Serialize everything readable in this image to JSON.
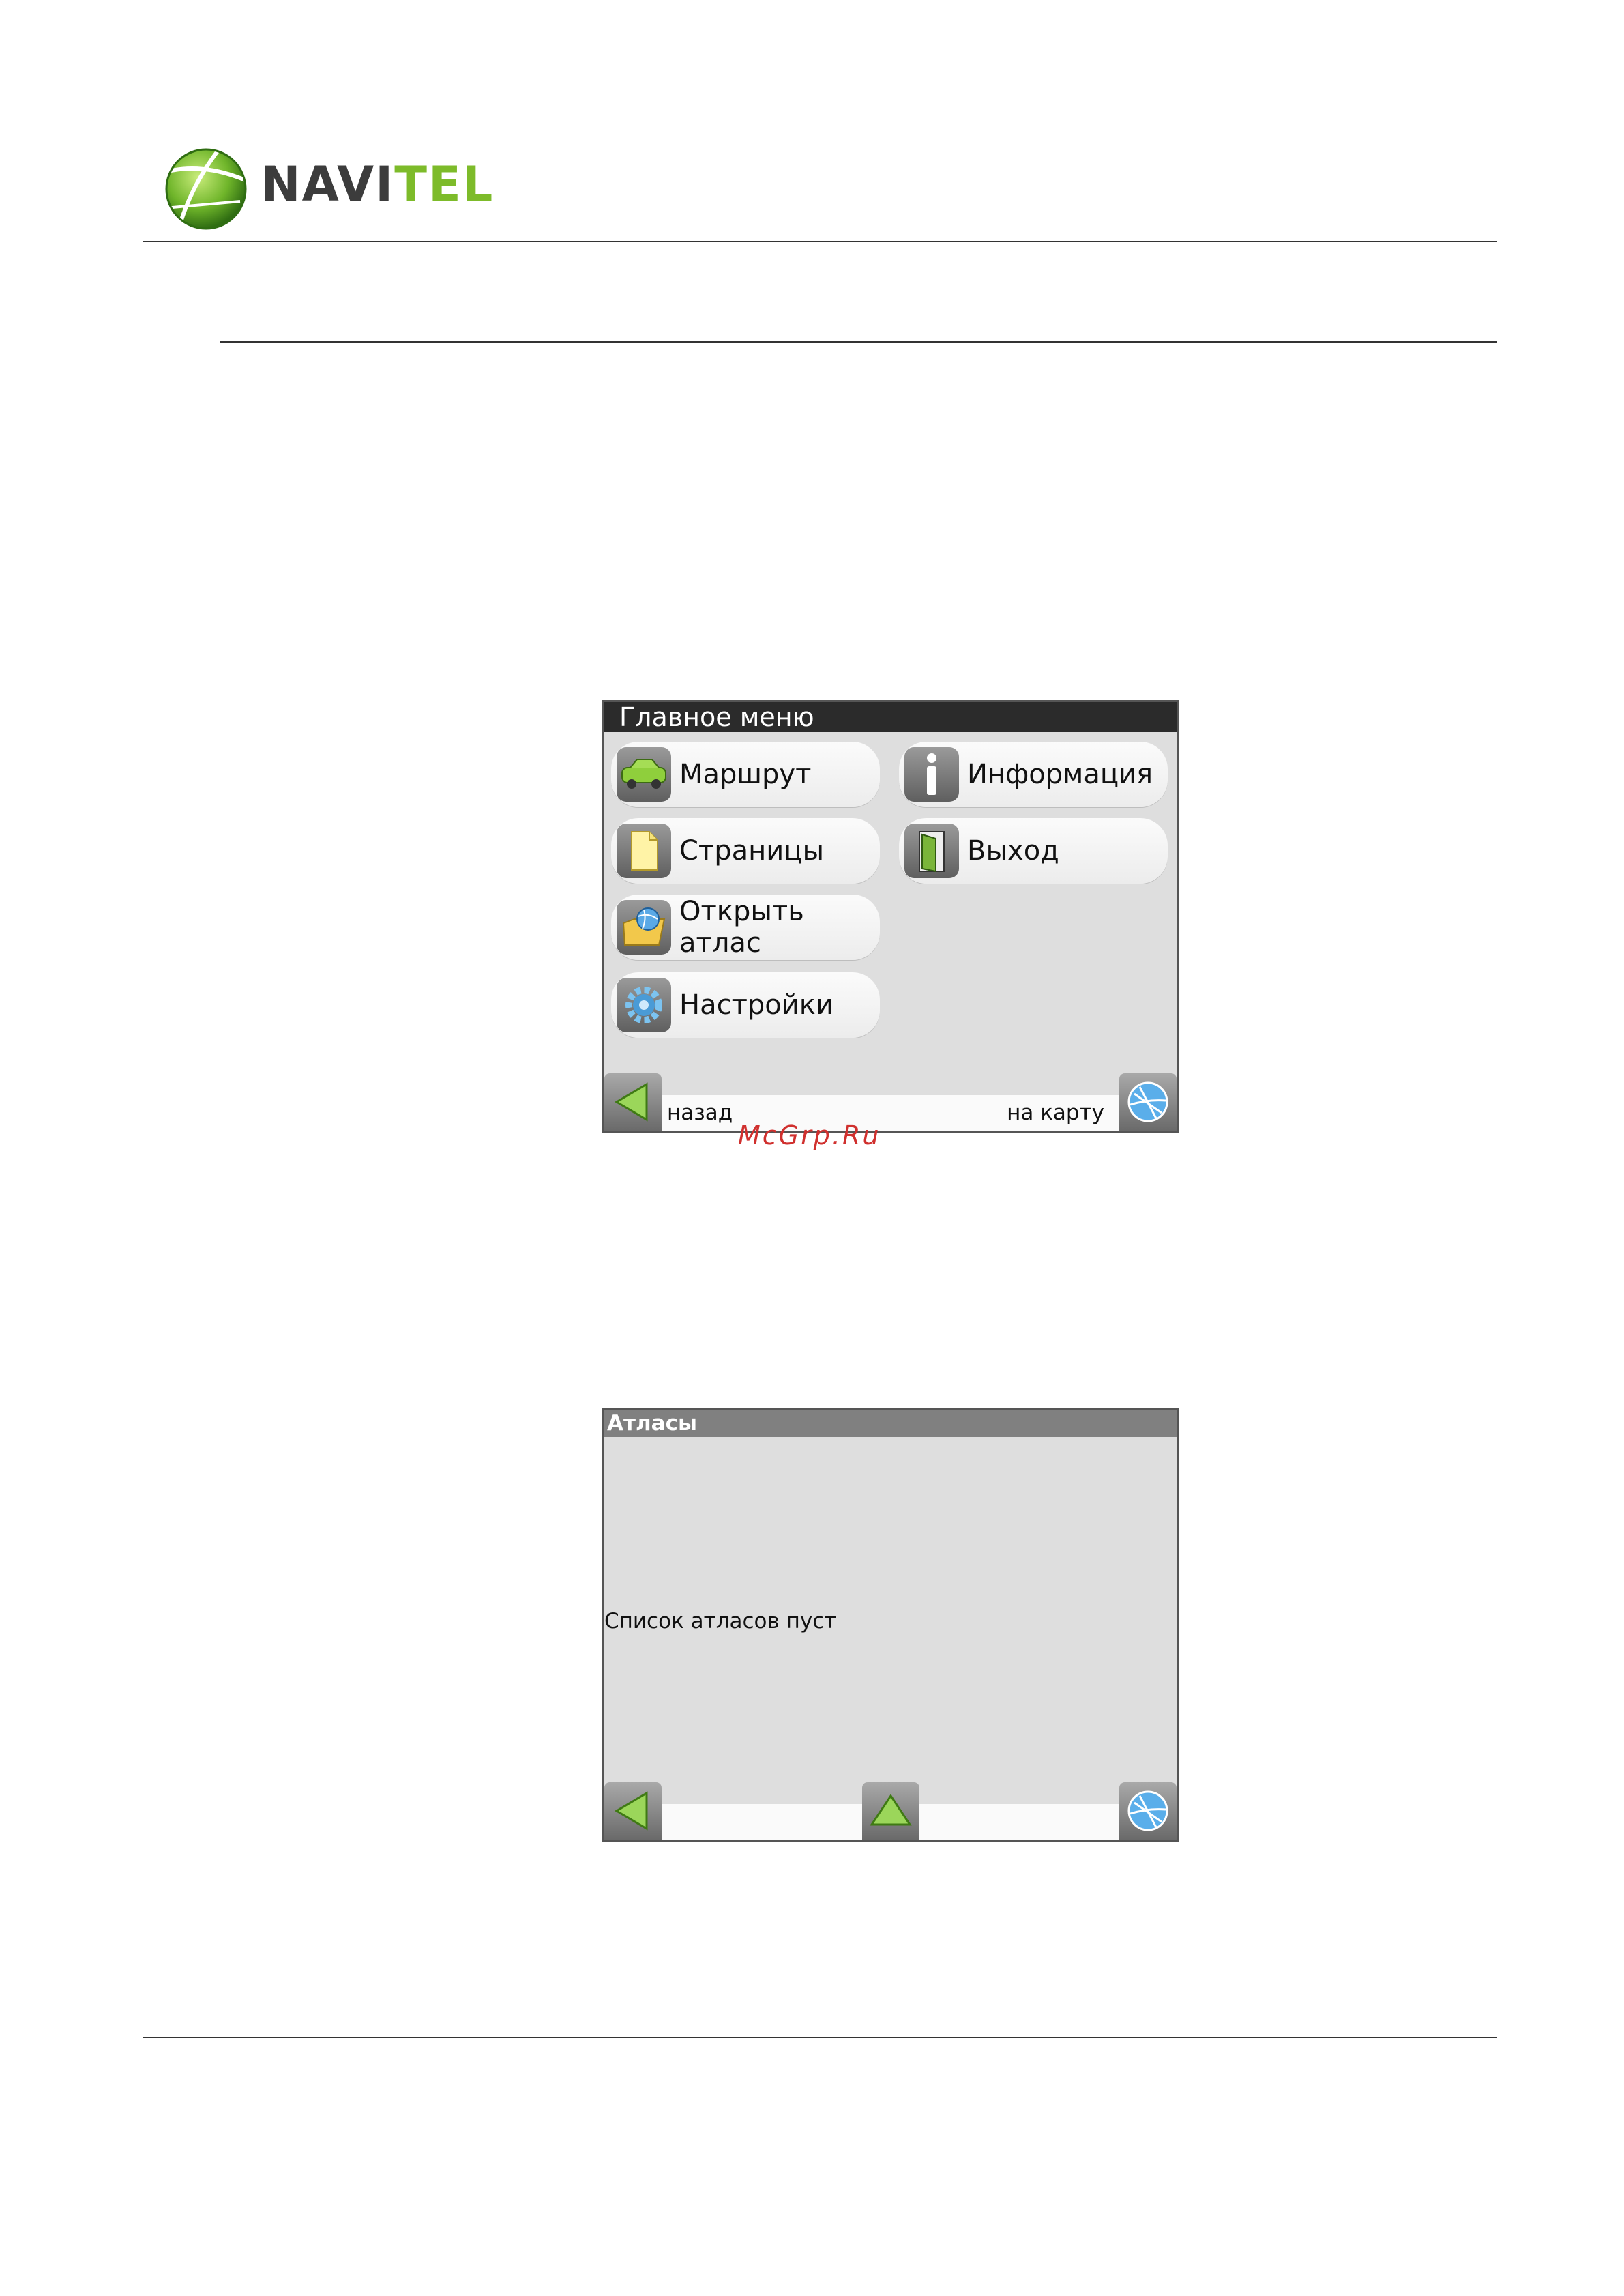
{
  "header": {
    "logo": {
      "brand_prefix": "NAVI",
      "brand_suffix": "TEL"
    }
  },
  "screen1": {
    "title": "Главное меню",
    "items": [
      {
        "label": "Маршрут",
        "icon": "car-icon"
      },
      {
        "label": "Информация",
        "icon": "info-icon"
      },
      {
        "label": "Страницы",
        "icon": "page-icon"
      },
      {
        "label": "Выход",
        "icon": "exit-door-icon"
      },
      {
        "label": "Открыть атлас",
        "icon": "open-atlas-icon"
      },
      {
        "label": "Настройки",
        "icon": "gear-icon"
      }
    ],
    "back_label": "назад",
    "map_label": "на карту"
  },
  "watermark": "McGrp.Ru",
  "screen2": {
    "title": "Атласы",
    "empty_message": "Список атласов пуст"
  },
  "colors": {
    "accent_green": "#7dbb2a",
    "watermark_red": "#d0302e",
    "title_dark": "#2b2b2b",
    "title_gray": "#808080"
  }
}
